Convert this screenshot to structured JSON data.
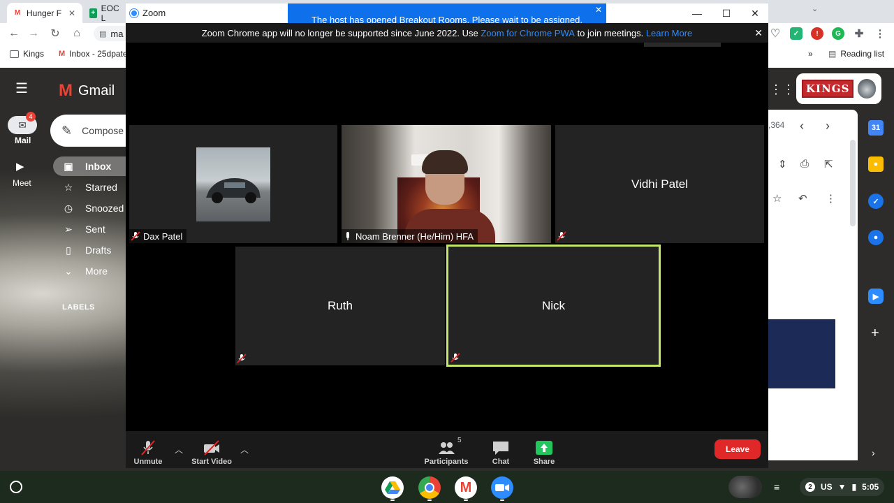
{
  "chrome": {
    "tabs": [
      {
        "label": "Hunger F",
        "favicon": "gmail-icon",
        "color": "#ea4335"
      },
      {
        "label": "EOC L",
        "favicon": "sheets-icon",
        "color": "#0f9d58"
      }
    ],
    "omnibox_text": "ma",
    "bookmarks": [
      {
        "label": "Kings"
      },
      {
        "label": "Inbox - 25dpate"
      }
    ],
    "overflow": "»",
    "reading_list": "Reading list"
  },
  "gmail": {
    "logo": "Gmail",
    "rail": {
      "mail_label": "Mail",
      "mail_badge": "4",
      "meet_label": "Meet"
    },
    "compose": "Compose",
    "nav": [
      {
        "label": "Inbox",
        "icon": "inbox-icon"
      },
      {
        "label": "Starred",
        "icon": "star-icon"
      },
      {
        "label": "Snoozed",
        "icon": "clock-icon"
      },
      {
        "label": "Sent",
        "icon": "send-icon"
      },
      {
        "label": "Drafts",
        "icon": "draft-icon"
      },
      {
        "label": "More",
        "icon": "chevron-down-icon"
      }
    ],
    "labels_header": "LABELS",
    "count_text": ",364",
    "kings_badge": "KINGS"
  },
  "zoom": {
    "window_title": "Zoom",
    "breakout_notice": "The host has opened Breakout Rooms. Please wait to be assigned.",
    "banner": {
      "text_before": "Zoom Chrome app will no longer be supported since June 2022. Use ",
      "link1": "Zoom for Chrome PWA",
      "text_middle": " to join meetings. ",
      "link2": "Learn More"
    },
    "participants": [
      {
        "name": "Dax Patel",
        "muted": true
      },
      {
        "name": "Noam Brenner (He/Him) HFA",
        "muted": false
      },
      {
        "name": "Vidhi Patel",
        "muted": true
      },
      {
        "name": "Ruth",
        "muted": true
      },
      {
        "name": "Nick",
        "muted": true,
        "active_speaker": true
      }
    ],
    "toolbar": {
      "unmute": "Unmute",
      "start_video": "Start Video",
      "participants": "Participants",
      "participants_count": "5",
      "chat": "Chat",
      "share": "Share",
      "leave": "Leave"
    },
    "colors": {
      "accent": "#2d8cff",
      "active_speaker": "#c5e86c",
      "leave": "#e02828",
      "share": "#22c55e"
    }
  },
  "shelf": {
    "apps": [
      "drive-icon",
      "chrome-icon",
      "gmail-icon",
      "zoom-icon"
    ],
    "tray": {
      "notifications": "2",
      "keyboard": "US",
      "time": "5:05"
    }
  }
}
